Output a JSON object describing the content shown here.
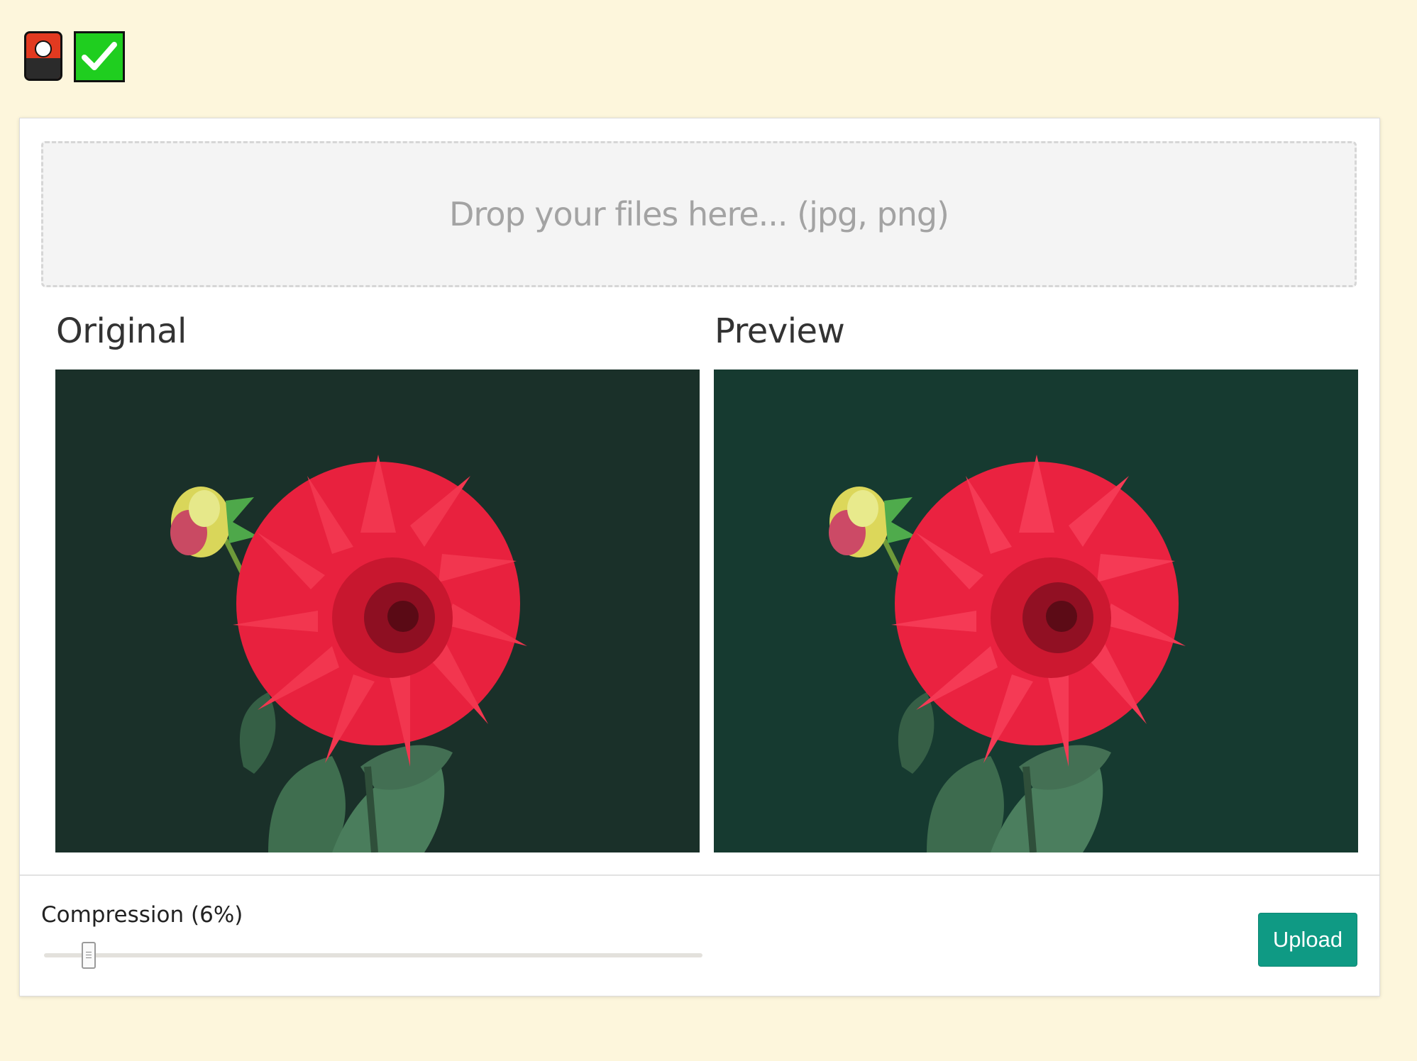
{
  "toolbar": {
    "icons": [
      "record-icon",
      "check-icon"
    ],
    "colors": {
      "record": "#e23a20",
      "check": "#1fce1f"
    }
  },
  "dropzone": {
    "text": "Drop your files here... (jpg, png)"
  },
  "panels": {
    "original_title": "Original",
    "preview_title": "Preview"
  },
  "compression": {
    "label": "Compression (6%)",
    "value_percent": 6
  },
  "actions": {
    "upload_label": "Upload"
  },
  "colors": {
    "page_background": "#fdf6dc",
    "accent": "#0f9a84",
    "image_background_original": "#1a3029",
    "image_background_preview": "#163a30",
    "flower": "#e8213e"
  }
}
